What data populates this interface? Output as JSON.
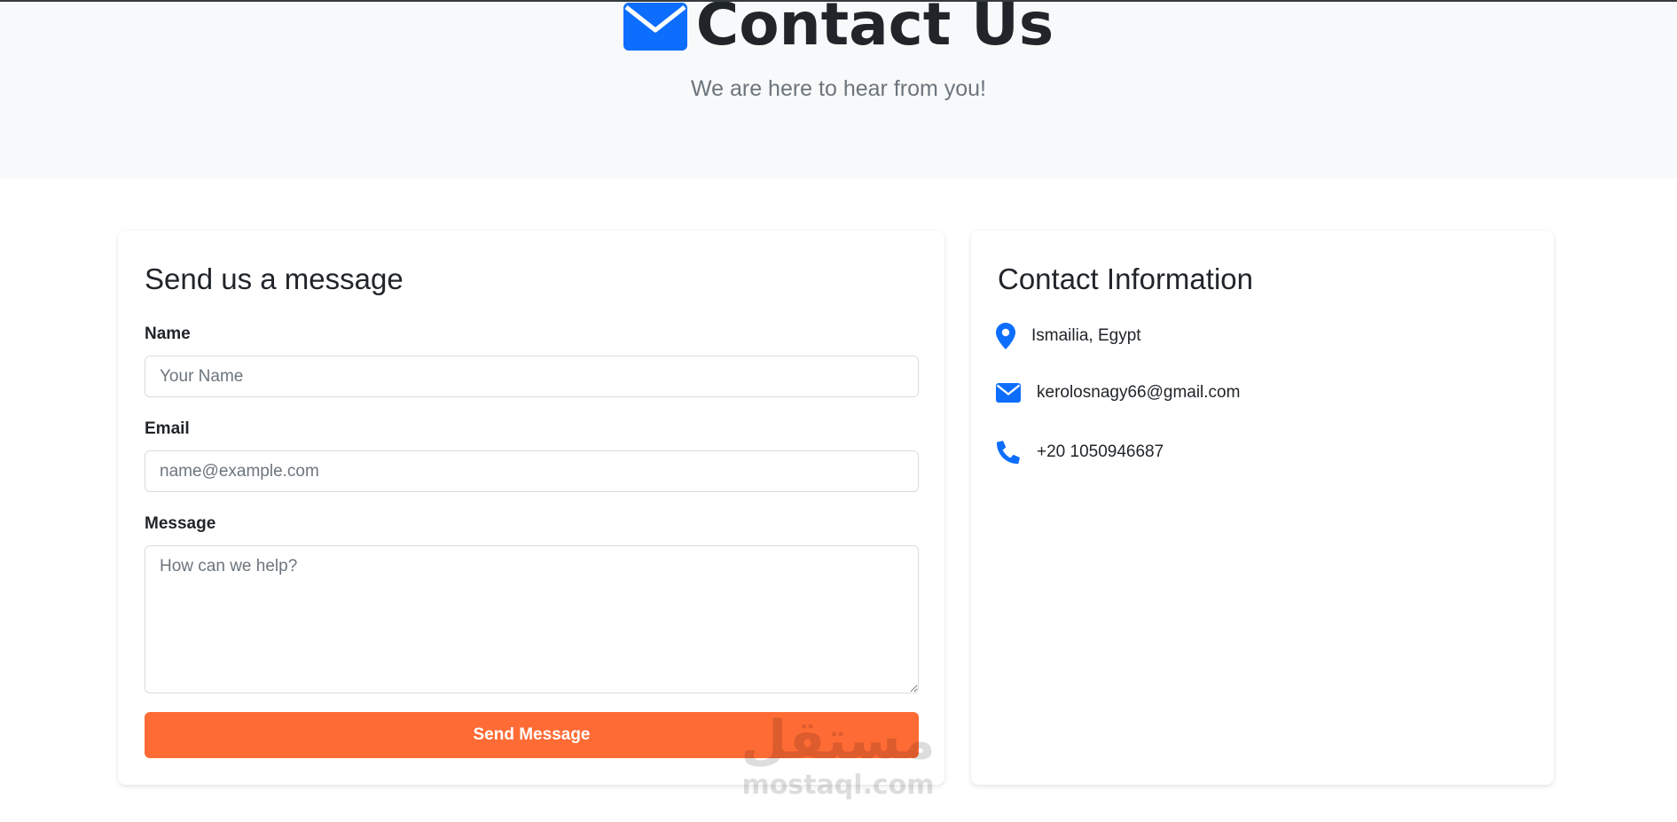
{
  "hero": {
    "title": "Contact Us",
    "title_icon": "envelope-icon",
    "subtitle": "We are here to hear from you!"
  },
  "form": {
    "heading": "Send us a message",
    "name_label": "Name",
    "name_placeholder": "Your Name",
    "name_value": "",
    "email_label": "Email",
    "email_placeholder": "name@example.com",
    "email_value": "",
    "message_label": "Message",
    "message_placeholder": "How can we help?",
    "message_value": "",
    "submit_label": "Send Message"
  },
  "info": {
    "heading": "Contact Information",
    "items": [
      {
        "icon": "map-marker-icon",
        "text": "Ismailia, Egypt"
      },
      {
        "icon": "envelope-icon",
        "text": "kerolosnagy66@gmail.com"
      },
      {
        "icon": "phone-icon",
        "text": "+20 1050946687"
      }
    ]
  },
  "watermark": {
    "arabic": "مستقل",
    "latin": "mostaql.com"
  },
  "colors": {
    "accent_blue": "#0d6efd",
    "button_orange": "#ff6b35",
    "hero_bg": "#f8f9fa",
    "text_dark": "#212529",
    "text_muted": "#6c757d"
  }
}
